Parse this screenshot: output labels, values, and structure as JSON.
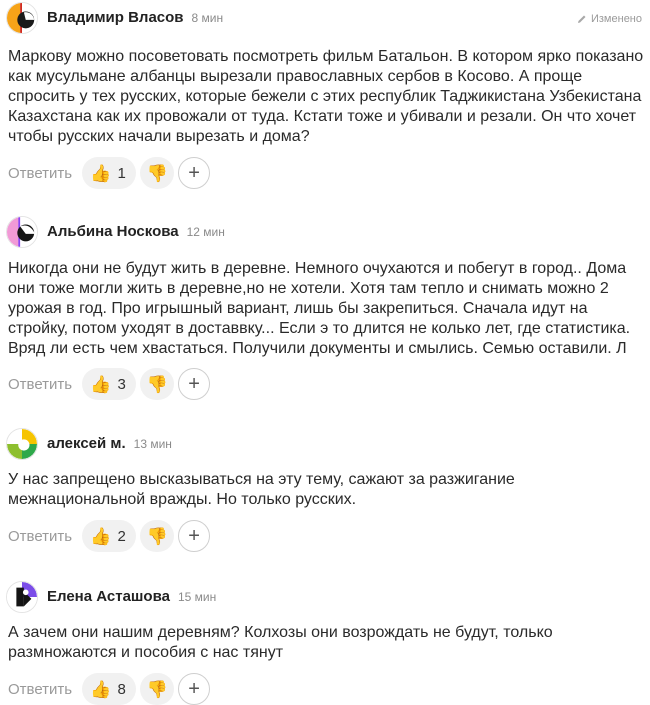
{
  "comments": [
    {
      "author": "Владимир Власов",
      "time": "8 мин",
      "edited": "Изменено",
      "text": "Маркову можно посоветовать посмотреть фильм Батальон. В котором ярко показано как мусульмане албанцы вырезали православных сербов в Косово. А проще спросить у тех русских, которые бежели с этих республик Таджикистана Узбекистана Казахстана как их провожали от туда. Кстати тоже и убивали и резали. Он что хочет чтобы русских начали вырезать и дома?",
      "reply": "Ответить",
      "likes": "1"
    },
    {
      "author": "Альбина Носкова",
      "time": "12 мин",
      "text": "Никогда они не будут жить в деревне. Немного очухаются и побегут в город.. Дома они тоже могли жить в деревне,но не хотели. Хотя там тепло и снимать можно 2 урожая в год. Про игрышный вариант, лишь бы закрепиться. Сначала идут на стройку, потом уходят в доставвку... Если э то длится не колько лет, где статистика. Вряд ли есть чем хвастаться. Получили документы и смылись. Семью оставили. Л",
      "reply": "Ответить",
      "likes": "3"
    },
    {
      "author": "алексей м.",
      "time": "13 мин",
      "text": "У нас запрещено высказываться на эту тему, сажают за разжигание межнациональной вражды. Но только русских.",
      "reply": "Ответить",
      "likes": "2"
    },
    {
      "author": "Елена Асташова",
      "time": "15 мин",
      "text": "А зачем они нашим деревням? Колхозы они возрождать не будут, только размножаются и пособия с нас тянут",
      "reply": "Ответить",
      "likes": "8"
    }
  ],
  "icons": {
    "like": "thumbs-up-icon",
    "dislike": "thumbs-down-icon",
    "add": "plus-icon",
    "edit": "pencil-icon"
  },
  "colors": {
    "pill_bg": "#f1f1f1",
    "muted_text": "#9a9a9a"
  }
}
